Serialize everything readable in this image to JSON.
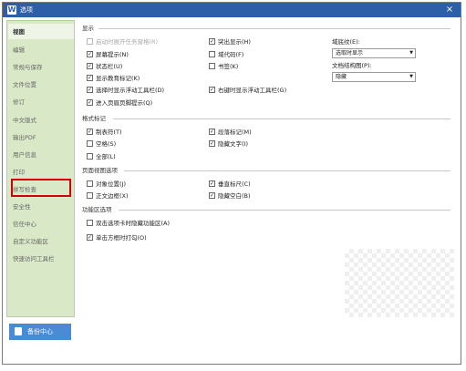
{
  "window": {
    "title": "选项",
    "app_icon_glyph": "W",
    "close_glyph": "×",
    "titlebar_color": "#2d5ea8"
  },
  "sidebar": {
    "items": [
      {
        "label": "视图",
        "active": true
      },
      {
        "label": "编辑"
      },
      {
        "label": "常规与保存"
      },
      {
        "label": "文件位置"
      },
      {
        "label": "修订"
      },
      {
        "label": "中文版式"
      },
      {
        "label": "输出PDF"
      },
      {
        "label": "用户信息"
      },
      {
        "label": "打印"
      },
      {
        "label": "拼写检查",
        "highlighted": true,
        "highlight_color": "#d40000"
      },
      {
        "label": "安全性"
      },
      {
        "label": "信任中心"
      },
      {
        "label": "自定义功能区"
      },
      {
        "label": "快速访问工具栏"
      }
    ],
    "background_color": "#d9e9c8"
  },
  "backup": {
    "label": "备份中心",
    "color": "#4a8bd6"
  },
  "display": {
    "heading": "显示",
    "options": [
      {
        "label": "启动时展开任务窗格(R)",
        "checked": false,
        "disabled": true
      },
      {
        "label": "屏幕提示(N)",
        "checked": true
      },
      {
        "label": "状态栏(U)",
        "checked": true
      },
      {
        "label": "显示教育标记(K)",
        "checked": true
      },
      {
        "label": "选择时显示浮动工具栏(D)",
        "checked": true
      },
      {
        "label": "进入页眉页脚提示(Q)",
        "checked": true
      },
      {
        "label": "突出显示(H)",
        "checked": true
      },
      {
        "label": "域代码(F)",
        "checked": false
      },
      {
        "label": "书签(K)",
        "checked": false
      },
      {
        "label": "右键时显示浮动工具栏(G)",
        "checked": true
      }
    ],
    "field_shading_label": "域底纹(E):",
    "field_shading_value": "选取时显示",
    "doc_structure_label": "文档结构图(P):",
    "doc_structure_value": "隐藏"
  },
  "formatting": {
    "heading": "格式标记",
    "options": [
      {
        "label": "制表符(T)",
        "checked": true
      },
      {
        "label": "空格(S)",
        "checked": false
      },
      {
        "label": "全部(L)",
        "checked": false
      },
      {
        "label": "段落标记(M)",
        "checked": true
      },
      {
        "label": "隐藏文字(I)",
        "checked": true
      }
    ]
  },
  "page_view": {
    "heading": "页面视图选项",
    "options": [
      {
        "label": "对象位置(J)",
        "checked": false
      },
      {
        "label": "正文边框(X)",
        "checked": false
      },
      {
        "label": "垂直标尺(C)",
        "checked": true
      },
      {
        "label": "隐藏空白(B)",
        "checked": true
      }
    ]
  },
  "ribbon": {
    "heading": "功能区选项",
    "options": [
      {
        "label": "双击选项卡时隐藏功能区(A)",
        "checked": false
      },
      {
        "label": "单击方框时打勾(O)",
        "checked": true
      }
    ]
  },
  "checkmark_glyph": "✓",
  "select_arrow_glyph": "▼"
}
